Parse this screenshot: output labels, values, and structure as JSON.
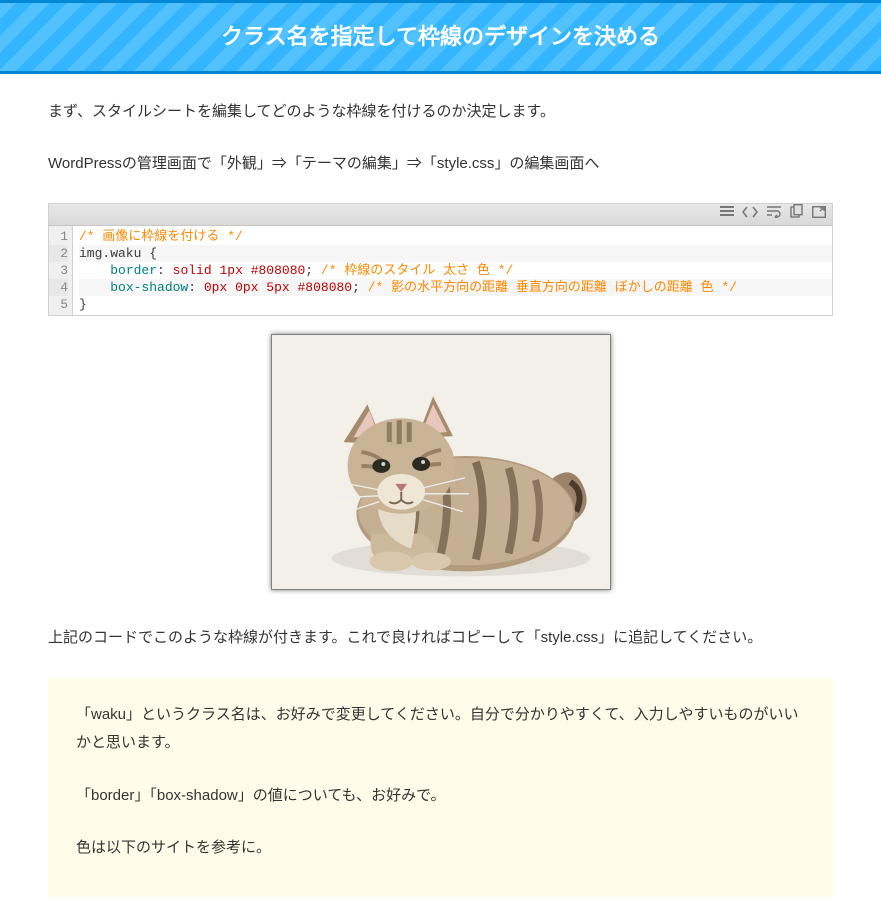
{
  "banner": {
    "title": "クラス名を指定して枠線のデザインを決める"
  },
  "content": {
    "p1": "まず、スタイルシートを編集してどのような枠線を付けるのか決定します。",
    "p2": "WordPressの管理画面で「外観」⇒「テーマの編集」⇒「style.css」の編集画面へ",
    "p3": "上記のコードでこのような枠線が付きます。これで良ければコピーして「style.css」に追記してください。"
  },
  "code": {
    "line_numbers": [
      "1",
      "2",
      "3",
      "4",
      "5"
    ],
    "lines": [
      {
        "parts": [
          {
            "c": "comment",
            "t": "/* 画像に枠線を付ける */"
          }
        ]
      },
      {
        "parts": [
          {
            "c": "plain",
            "t": "img.waku {"
          }
        ]
      },
      {
        "parts": [
          {
            "c": "plain",
            "t": "    "
          },
          {
            "c": "key",
            "t": "border"
          },
          {
            "c": "plain",
            "t": ": "
          },
          {
            "c": "val",
            "t": "solid"
          },
          {
            "c": "plain",
            "t": " "
          },
          {
            "c": "val",
            "t": "1px"
          },
          {
            "c": "plain",
            "t": " "
          },
          {
            "c": "val",
            "t": "#808080"
          },
          {
            "c": "plain",
            "t": "; "
          },
          {
            "c": "comment",
            "t": "/* 枠線のスタイル 太さ 色 */"
          }
        ]
      },
      {
        "parts": [
          {
            "c": "plain",
            "t": "    "
          },
          {
            "c": "key",
            "t": "box-shadow"
          },
          {
            "c": "plain",
            "t": ": "
          },
          {
            "c": "val",
            "t": "0px"
          },
          {
            "c": "plain",
            "t": " "
          },
          {
            "c": "val",
            "t": "0px"
          },
          {
            "c": "plain",
            "t": " "
          },
          {
            "c": "val",
            "t": "5px"
          },
          {
            "c": "plain",
            "t": " "
          },
          {
            "c": "val",
            "t": "#808080"
          },
          {
            "c": "plain",
            "t": "; "
          },
          {
            "c": "comment",
            "t": "/* 影の水平方向の距離 垂直方向の距離 ぼかしの距離 色 */"
          }
        ]
      },
      {
        "parts": [
          {
            "c": "plain",
            "t": "}"
          }
        ]
      }
    ]
  },
  "note": {
    "p1": "「waku」というクラス名は、お好みで変更してください。自分で分かりやすくて、入力しやすいものがいいかと思います。",
    "p2": "「border」「box-shadow」の値についても、お好みで。",
    "p3": "色は以下のサイトを参考に。"
  }
}
